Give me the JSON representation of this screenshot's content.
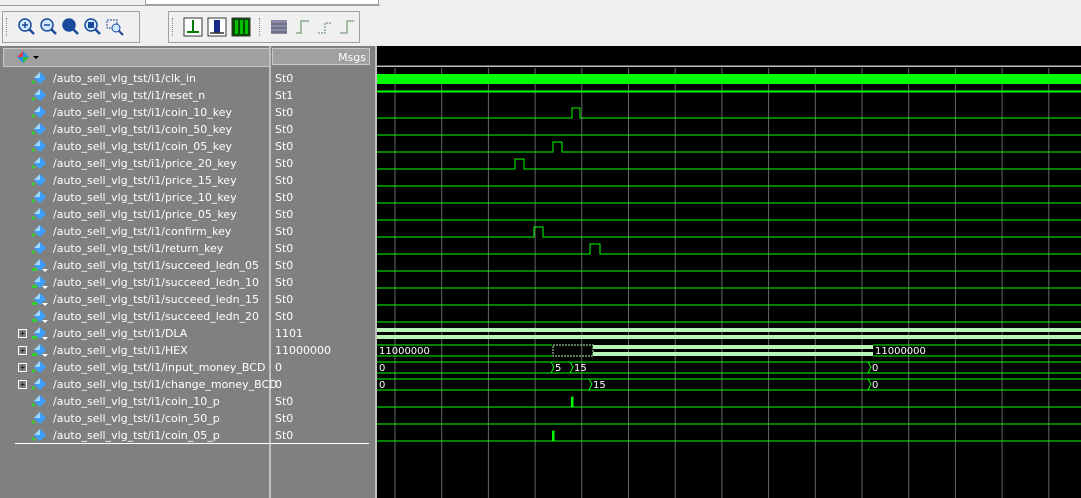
{
  "colors": {
    "wave_green": "#00ff00",
    "bus_light": "#b8f4b8",
    "grid": "#666666",
    "panel_bg": "#808080"
  },
  "toolbar": {
    "buttons": [
      {
        "name": "zoom-in-icon"
      },
      {
        "name": "zoom-out-icon"
      },
      {
        "name": "zoom-full-icon"
      },
      {
        "name": "zoom-in-cursor-icon"
      },
      {
        "name": "zoom-region-icon"
      },
      {
        "name": "insert-cursor-icon"
      },
      {
        "name": "edge-prev-icon"
      },
      {
        "name": "edge-next-icon"
      },
      {
        "name": "waveform-compress-icon"
      },
      {
        "name": "rising-edge-icon"
      },
      {
        "name": "falling-edge-icon"
      },
      {
        "name": "any-edge-icon"
      }
    ]
  },
  "panel": {
    "msgs_label": "Msgs",
    "header_icon": "wave-list-icon"
  },
  "signals": [
    {
      "name": "/auto_sell_vlg_tst/i1/clk_in",
      "value": "St0",
      "kind": "in",
      "expand": false
    },
    {
      "name": "/auto_sell_vlg_tst/i1/reset_n",
      "value": "St1",
      "kind": "in",
      "expand": false
    },
    {
      "name": "/auto_sell_vlg_tst/i1/coin_10_key",
      "value": "St0",
      "kind": "in",
      "expand": false
    },
    {
      "name": "/auto_sell_vlg_tst/i1/coin_50_key",
      "value": "St0",
      "kind": "in",
      "expand": false
    },
    {
      "name": "/auto_sell_vlg_tst/i1/coin_05_key",
      "value": "St0",
      "kind": "in",
      "expand": false
    },
    {
      "name": "/auto_sell_vlg_tst/i1/price_20_key",
      "value": "St0",
      "kind": "in",
      "expand": false
    },
    {
      "name": "/auto_sell_vlg_tst/i1/price_15_key",
      "value": "St0",
      "kind": "in",
      "expand": false
    },
    {
      "name": "/auto_sell_vlg_tst/i1/price_10_key",
      "value": "St0",
      "kind": "in",
      "expand": false
    },
    {
      "name": "/auto_sell_vlg_tst/i1/price_05_key",
      "value": "St0",
      "kind": "in",
      "expand": false
    },
    {
      "name": "/auto_sell_vlg_tst/i1/confirm_key",
      "value": "St0",
      "kind": "in",
      "expand": false
    },
    {
      "name": "/auto_sell_vlg_tst/i1/return_key",
      "value": "St0",
      "kind": "in",
      "expand": false
    },
    {
      "name": "/auto_sell_vlg_tst/i1/succeed_ledn_05",
      "value": "St0",
      "kind": "out",
      "expand": false
    },
    {
      "name": "/auto_sell_vlg_tst/i1/succeed_ledn_10",
      "value": "St0",
      "kind": "out",
      "expand": false
    },
    {
      "name": "/auto_sell_vlg_tst/i1/succeed_ledn_15",
      "value": "St0",
      "kind": "out",
      "expand": false
    },
    {
      "name": "/auto_sell_vlg_tst/i1/succeed_ledn_20",
      "value": "St0",
      "kind": "out",
      "expand": false
    },
    {
      "name": "/auto_sell_vlg_tst/i1/DLA",
      "value": "1101",
      "kind": "out",
      "expand": true
    },
    {
      "name": "/auto_sell_vlg_tst/i1/HEX",
      "value": "11000000",
      "kind": "out",
      "expand": true
    },
    {
      "name": "/auto_sell_vlg_tst/i1/input_money_BCD",
      "value": "0",
      "kind": "in",
      "expand": true
    },
    {
      "name": "/auto_sell_vlg_tst/i1/change_money_BCD",
      "value": "0",
      "kind": "in",
      "expand": true
    },
    {
      "name": "/auto_sell_vlg_tst/i1/coin_10_p",
      "value": "St0",
      "kind": "in",
      "expand": false
    },
    {
      "name": "/auto_sell_vlg_tst/i1/coin_50_p",
      "value": "St0",
      "kind": "in",
      "expand": false
    },
    {
      "name": "/auto_sell_vlg_tst/i1/coin_05_p",
      "value": "St0",
      "kind": "in",
      "expand": false
    }
  ],
  "bus_labels": {
    "hex_start": "11000000",
    "hex_end": "11000000",
    "input_start": "0",
    "input_v1": "5",
    "input_v2": "15",
    "input_end": "0",
    "change_start": "0",
    "change_v1": "15",
    "change_end": "0"
  }
}
